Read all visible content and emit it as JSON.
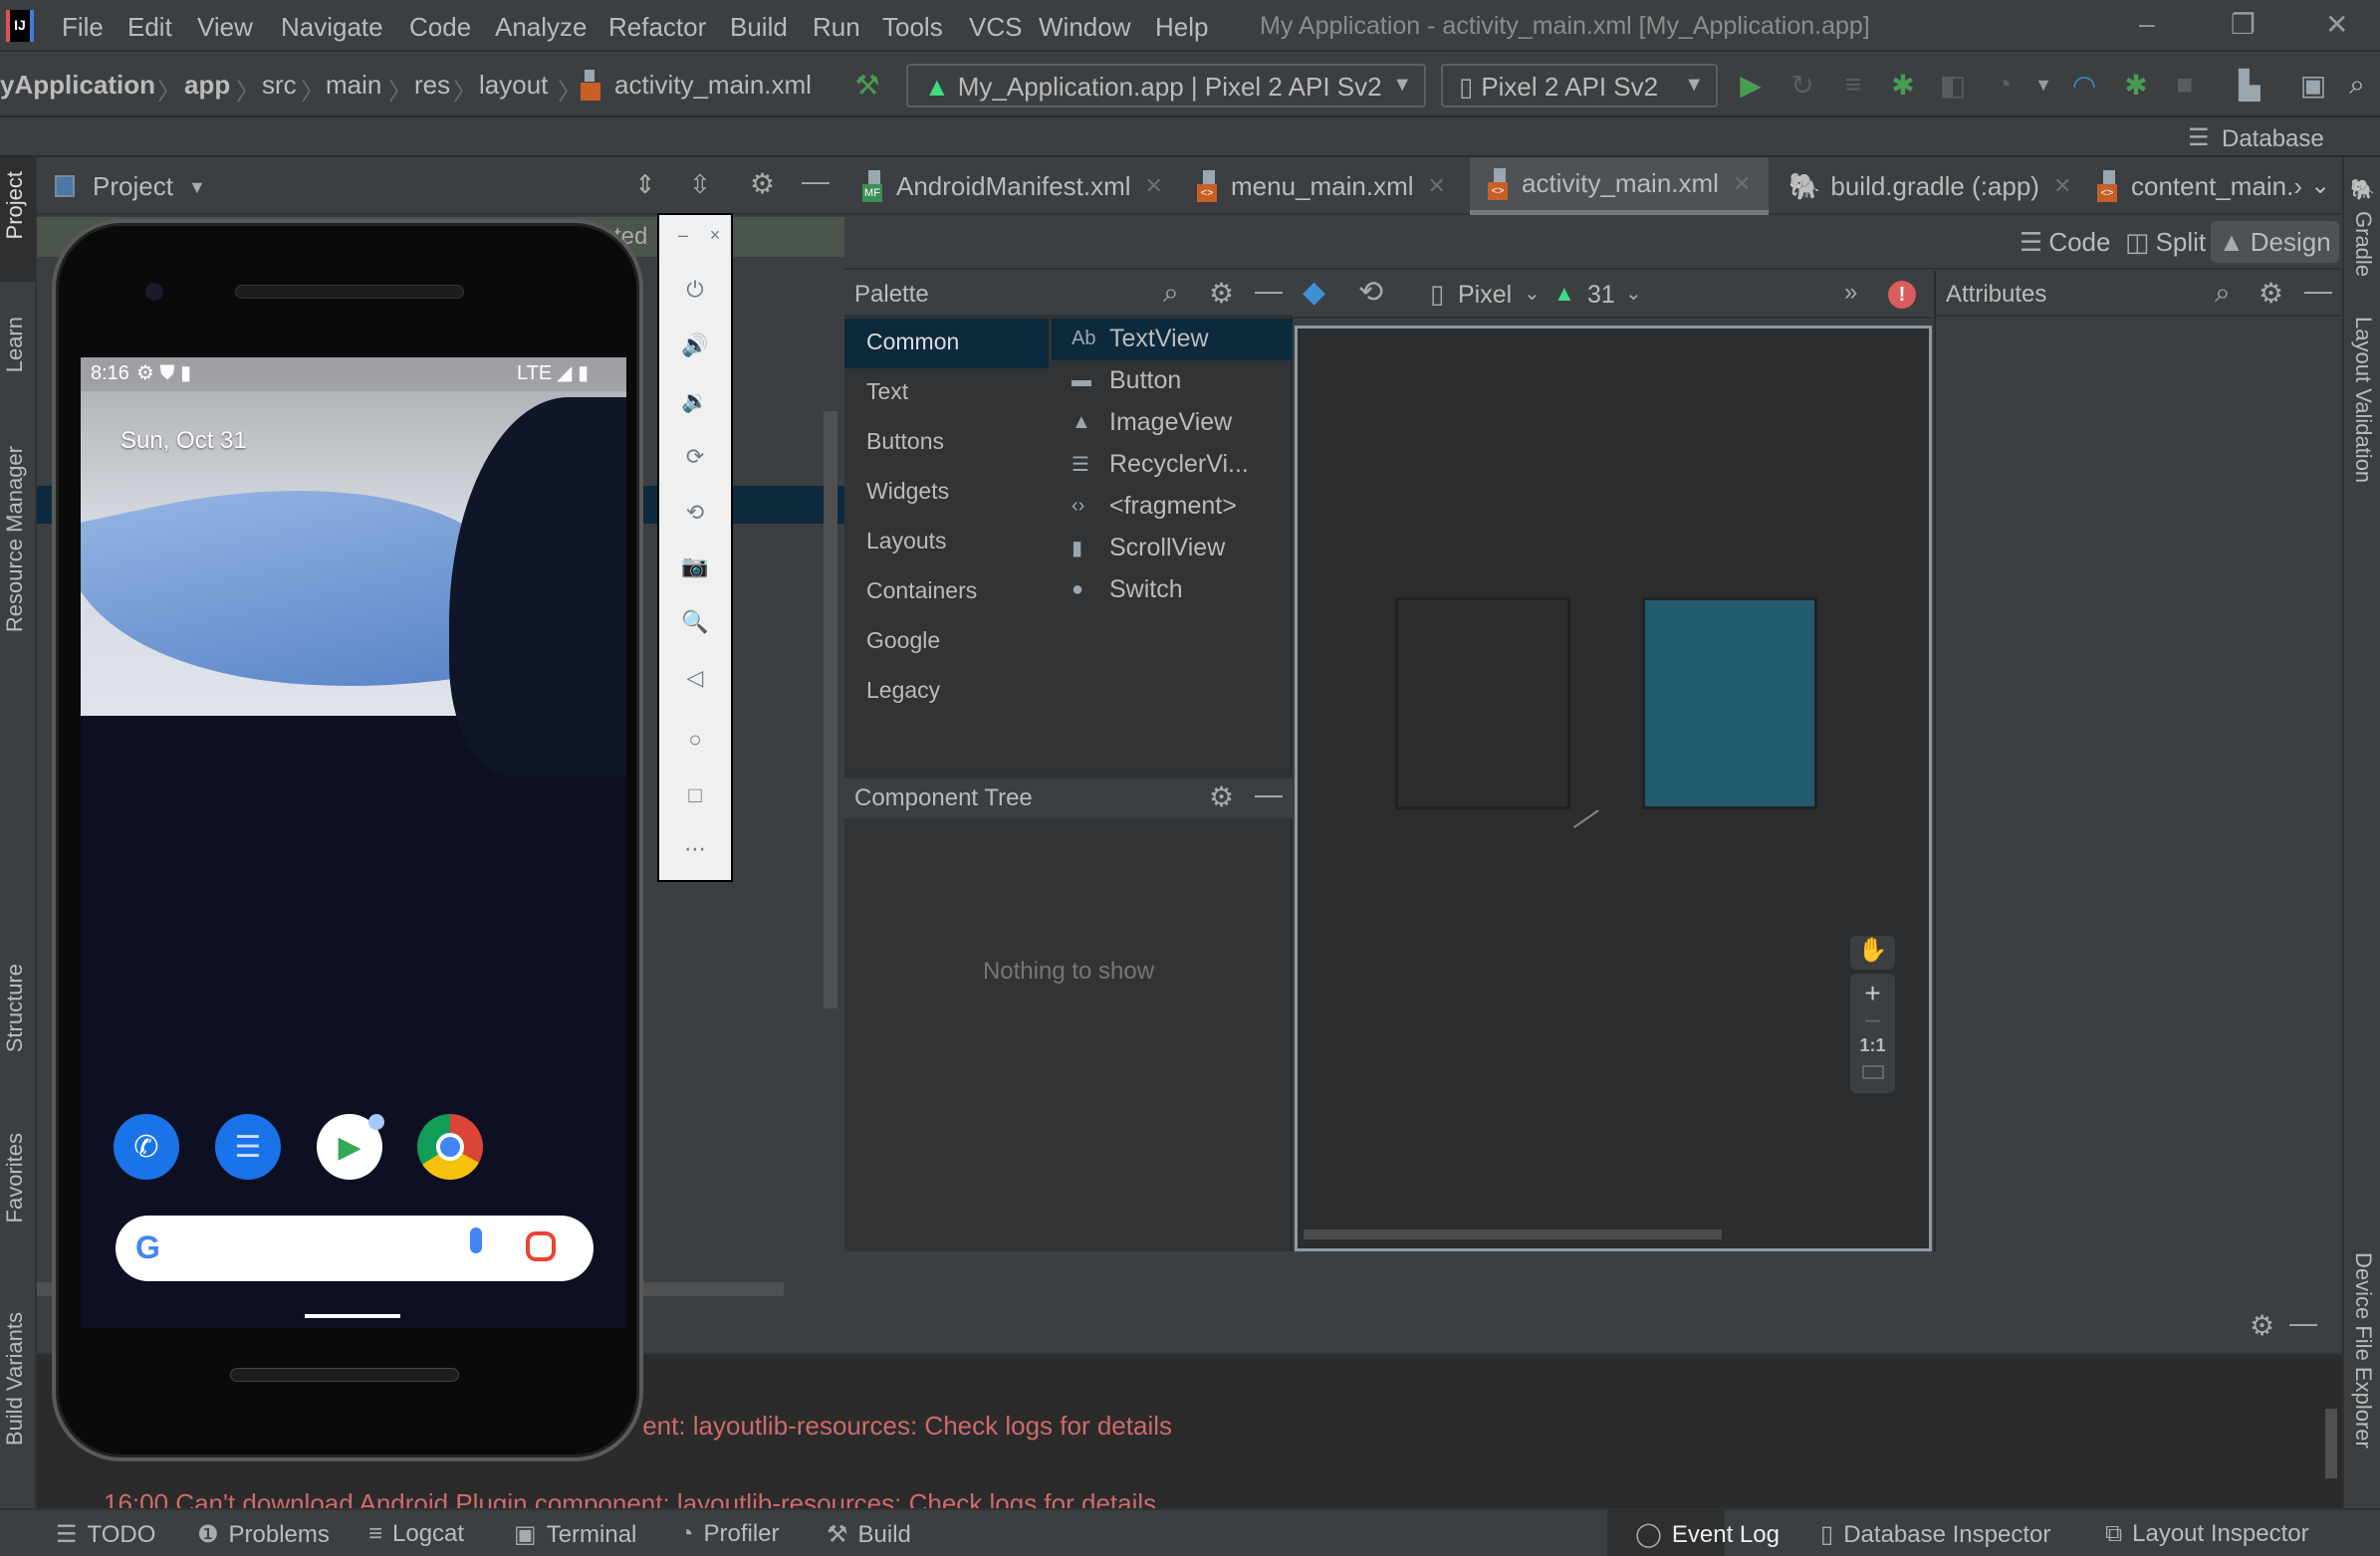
{
  "window": {
    "title": "My Application - activity_main.xml [My_Application.app]",
    "controls": {
      "minimize": "–",
      "restore": "❐",
      "close": "✕"
    }
  },
  "menu": [
    "File",
    "Edit",
    "View",
    "Navigate",
    "Code",
    "Analyze",
    "Refactor",
    "Build",
    "Run",
    "Tools",
    "VCS",
    "Window",
    "Help"
  ],
  "breadcrumb": [
    "yApplication",
    "app",
    "src",
    "main",
    "res",
    "layout",
    "activity_main.xml"
  ],
  "toolbar": {
    "run_config": "My_Application.app | Pixel 2 API Sv2",
    "device": "Pixel 2 API Sv2",
    "database_label": "Database",
    "accent_green": "#499c54",
    "accent_blue": "#3592c4"
  },
  "left_stripe": [
    "Project",
    "Learn",
    "Resource Manager",
    "Structure",
    "Favorites",
    "Build Variants"
  ],
  "right_stripe": [
    "Gradle",
    "Layout Validation",
    "Device File Explorer"
  ],
  "project_panel": {
    "title": "Project",
    "partial_text": "ted"
  },
  "editor_tabs": [
    {
      "label": "AndroidManifest.xml",
      "badge": "MF",
      "badge_color": "#3d8f58",
      "active": false
    },
    {
      "label": "menu_main.xml",
      "badge": "<>",
      "badge_color": "#c75f27",
      "active": false
    },
    {
      "label": "activity_main.xml",
      "badge": "<>",
      "badge_color": "#c75f27",
      "active": true
    },
    {
      "label": "build.gradle (:app)",
      "badge": "",
      "badge_color": "",
      "active": false
    },
    {
      "label": "content_main.›",
      "badge": "<>",
      "badge_color": "#c75f27",
      "active": false
    }
  ],
  "view_modes": {
    "code": "Code",
    "split": "Split",
    "design": "Design",
    "active": "Design"
  },
  "palette": {
    "title": "Palette",
    "categories": [
      "Common",
      "Text",
      "Buttons",
      "Widgets",
      "Layouts",
      "Containers",
      "Google",
      "Legacy"
    ],
    "selected_category": "Common",
    "items": [
      {
        "icon": "Ab",
        "label": "TextView"
      },
      {
        "icon": "▬",
        "label": "Button"
      },
      {
        "icon": "▲",
        "label": "ImageView"
      },
      {
        "icon": "☰",
        "label": "RecyclerVi..."
      },
      {
        "icon": "‹›",
        "label": "<fragment>"
      },
      {
        "icon": "▮",
        "label": "ScrollView"
      },
      {
        "icon": "●",
        "label": "Switch"
      }
    ]
  },
  "component_tree": {
    "title": "Component Tree",
    "empty_text": "Nothing to show"
  },
  "design_toolbar": {
    "device": "Pixel",
    "api_level": "31",
    "more": "»",
    "error_color": "#db5c5c"
  },
  "canvas": {
    "design_frame_color": "#235c70",
    "zoom_controls": [
      "+",
      "–",
      "1:1"
    ]
  },
  "attributes": {
    "title": "Attributes"
  },
  "bottom_panel": {
    "log_lines": [
      "ent: layoutlib-resources: Check logs for details",
      "16:00   Can't download Android Plugin component: layoutlib-resources: Check logs for details"
    ],
    "log_color": "#cf6a6a"
  },
  "status_bar": {
    "left": [
      {
        "icon": "☰",
        "label": "TODO"
      },
      {
        "icon": "❶",
        "label": "Problems"
      },
      {
        "icon": "≡",
        "label": "Logcat"
      },
      {
        "icon": "▣",
        "label": "Terminal"
      },
      {
        "icon": "◔",
        "label": "Profiler"
      },
      {
        "icon": "⚒",
        "label": "Build"
      }
    ],
    "right": [
      {
        "icon": "◯",
        "label": "Event Log"
      },
      {
        "icon": "▯",
        "label": "Database Inspector"
      },
      {
        "icon": "⧉",
        "label": "Layout Inspector"
      }
    ]
  },
  "emulator": {
    "status_time": "8:16",
    "network": "LTE",
    "date": "Sun, Oct 31",
    "apps": [
      "Phone",
      "Messages",
      "Play Store",
      "Chrome"
    ],
    "side_buttons": [
      "–",
      "×",
      "⏻",
      "🔊",
      "🔉",
      "⟳",
      "⟲",
      "📷",
      "🔍",
      "◁",
      "○",
      "□",
      "⋯"
    ]
  }
}
